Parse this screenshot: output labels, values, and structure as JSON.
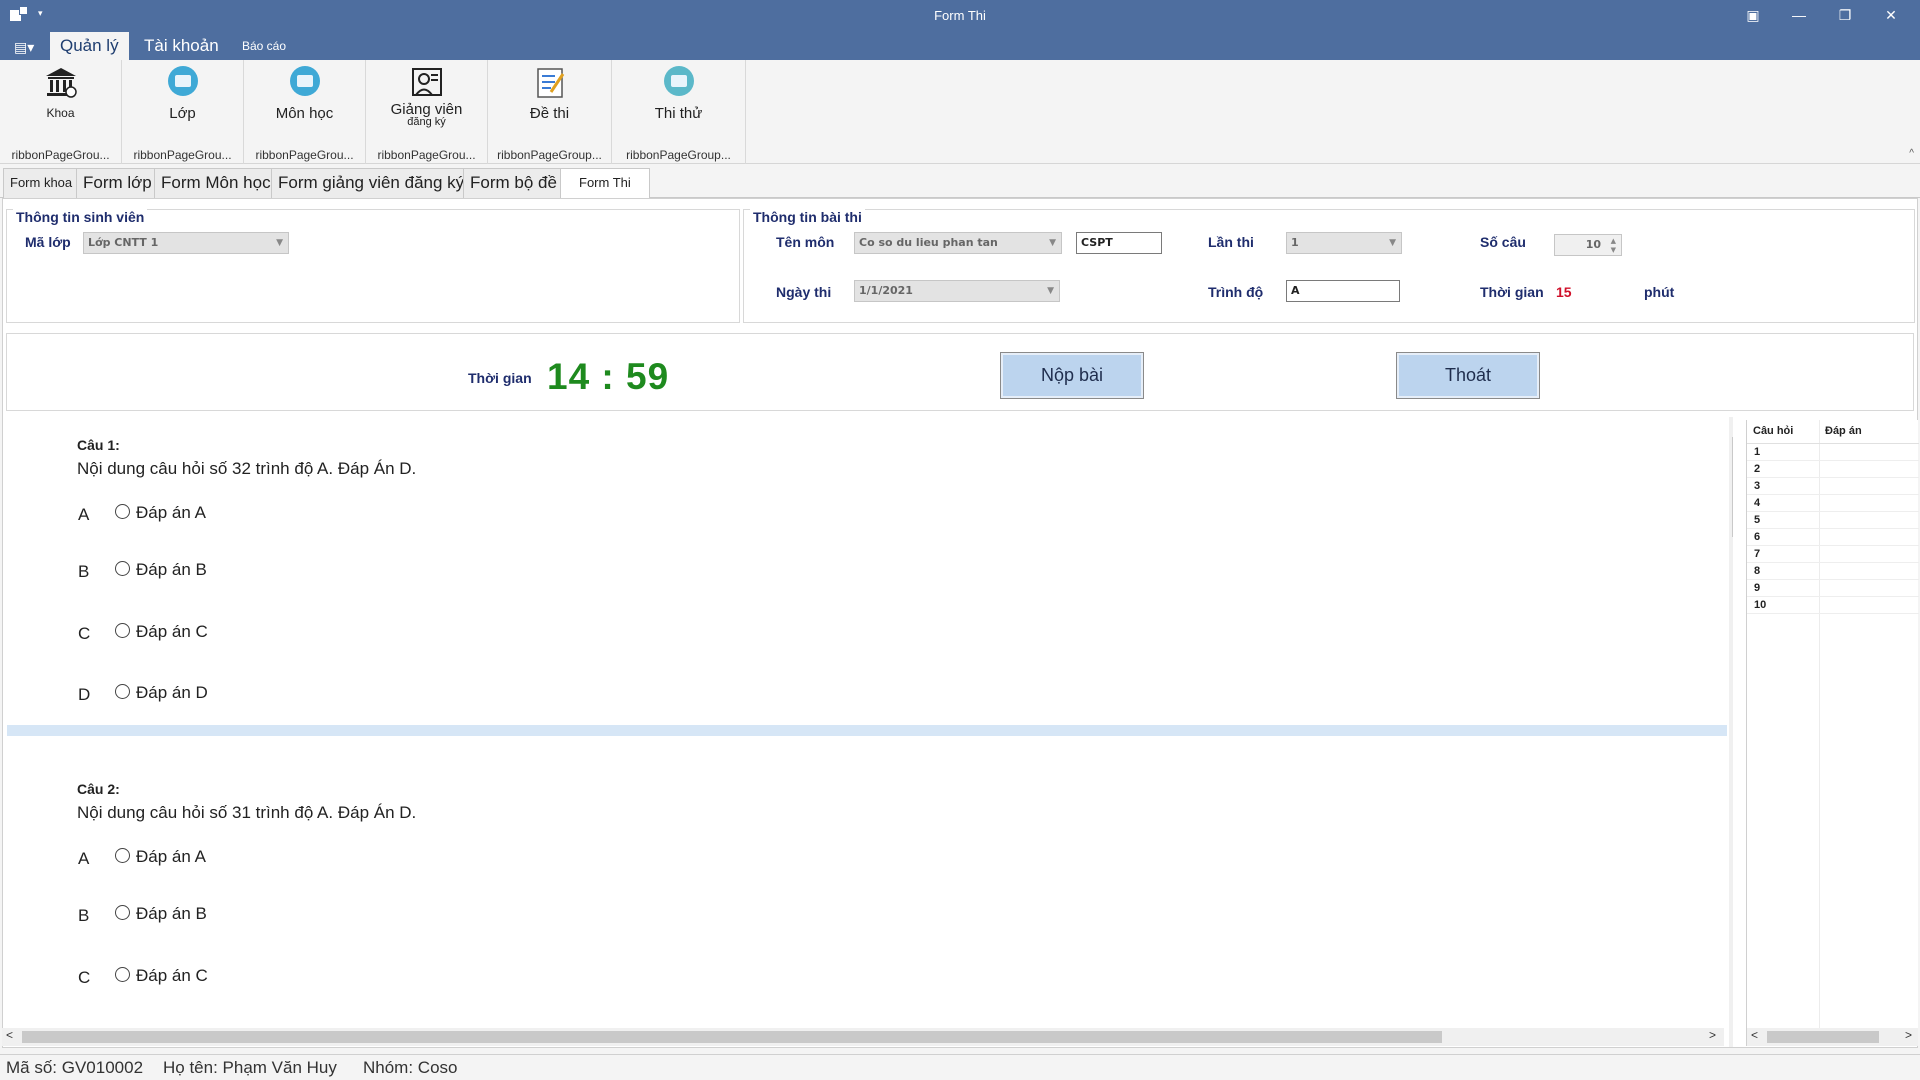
{
  "window": {
    "title": "Form Thi",
    "buttons": [
      "▣",
      "—",
      "❐",
      "✕"
    ]
  },
  "ribbon": {
    "file_button": "▤▾",
    "tabs": [
      {
        "label": "Quản lý"
      },
      {
        "label": "Tài khoản"
      },
      {
        "label": "Báo cáo"
      }
    ],
    "groups": [
      {
        "label": "Khoa",
        "caption": "ribbonPageGrou..."
      },
      {
        "label": "Lớp",
        "caption": "ribbonPageGrou..."
      },
      {
        "label": "Môn học",
        "caption": "ribbonPageGrou..."
      },
      {
        "label": "Giảng viên",
        "sublabel": "đăng ký",
        "caption": "ribbonPageGrou..."
      },
      {
        "label": "Đề thi",
        "caption": "ribbonPageGroup..."
      },
      {
        "label": "Thi thử",
        "caption": "ribbonPageGroup..."
      }
    ],
    "collapse": "^"
  },
  "doc_tabs": [
    {
      "label": "Form khoa"
    },
    {
      "label": "Form lớp"
    },
    {
      "label": "Form Môn học"
    },
    {
      "label": "Form giảng viên đăng ký"
    },
    {
      "label": "Form bộ đề"
    },
    {
      "label": "Form Thi"
    }
  ],
  "student_info": {
    "title": "Thông tin sinh viên",
    "class_label": "Mã lớp",
    "class_value": "Lớp CNTT 1"
  },
  "exam_info": {
    "title": "Thông tin bài thi",
    "subject_label": "Tên môn",
    "subject_value": "Co so du lieu phan tan",
    "subject_code": "CSPT",
    "attempt_label": "Lần thi",
    "attempt_value": "1",
    "count_label": "Số câu",
    "count_value": "10",
    "date_label": "Ngày thi",
    "date_value": "1/1/2021",
    "level_label": "Trình độ",
    "level_value": "A",
    "time_label": "Thời gian",
    "time_value": "15",
    "time_unit": "phút"
  },
  "timer": {
    "label": "Thời gian",
    "value": "14 : 59",
    "submit_label": "Nộp bài",
    "exit_label": "Thoát"
  },
  "questions": [
    {
      "title": "Câu 1:",
      "text": "Nội dung câu hỏi số 32 trình độ A. Đáp Án D.",
      "options": [
        {
          "letter": "A",
          "label": "Đáp án A"
        },
        {
          "letter": "B",
          "label": "Đáp án B"
        },
        {
          "letter": "C",
          "label": "Đáp án C"
        },
        {
          "letter": "D",
          "label": "Đáp án D"
        }
      ]
    },
    {
      "title": "Câu 2:",
      "text": "Nội dung câu hỏi số 31 trình độ A. Đáp Án D.",
      "options": [
        {
          "letter": "A",
          "label": "Đáp án A"
        },
        {
          "letter": "B",
          "label": "Đáp án B"
        },
        {
          "letter": "C",
          "label": "Đáp án C"
        }
      ]
    }
  ],
  "answer_grid": {
    "col_question": "Câu hỏi",
    "col_answer": "Đáp án",
    "rows": [
      "1",
      "2",
      "3",
      "4",
      "5",
      "6",
      "7",
      "8",
      "9",
      "10"
    ]
  },
  "status": {
    "id_text": "Mã số: GV010002",
    "name_text": "Họ tên: Phạm Văn Huy",
    "group_text": "Nhóm: Coso"
  },
  "colors": {
    "titlebar": "#4e6e9f",
    "label_blue": "#1f2d6d",
    "timer_green": "#1e8a1e",
    "time_red": "#d0102a",
    "button_blue": "#bcd4ee"
  }
}
